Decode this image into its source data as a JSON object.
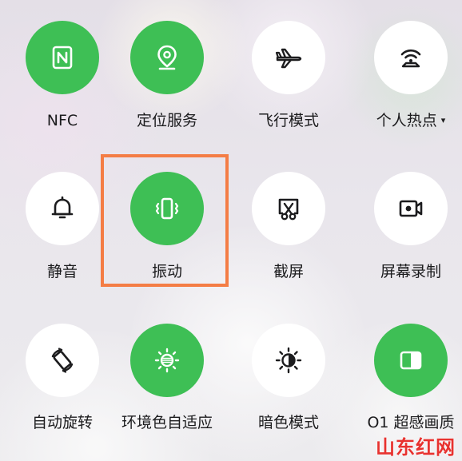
{
  "tiles": [
    {
      "label": "NFC",
      "state": "on",
      "icon": "nfc-icon"
    },
    {
      "label": "定位服务",
      "state": "on",
      "icon": "location-pin-icon"
    },
    {
      "label": "飞行模式",
      "state": "off",
      "icon": "airplane-icon"
    },
    {
      "label": "个人热点",
      "state": "off",
      "icon": "hotspot-icon",
      "has_dropdown": true,
      "dropdown_glyph": "▾"
    },
    {
      "label": "静音",
      "state": "off",
      "icon": "bell-icon"
    },
    {
      "label": "振动",
      "state": "on",
      "icon": "vibrate-icon",
      "highlighted": true
    },
    {
      "label": "截屏",
      "state": "off",
      "icon": "screenshot-icon"
    },
    {
      "label": "屏幕录制",
      "state": "off",
      "icon": "screen-record-icon"
    },
    {
      "label": "自动旋转",
      "state": "off",
      "icon": "auto-rotate-icon"
    },
    {
      "label": "环境色自适应",
      "state": "on",
      "icon": "ambient-color-icon"
    },
    {
      "label": "暗色模式",
      "state": "off",
      "icon": "dark-mode-icon"
    },
    {
      "label": "O1 超感画质",
      "state": "on",
      "icon": "display-quality-icon"
    }
  ],
  "colors": {
    "active": "#3ebf55",
    "inactive": "#ffffff",
    "icon_dark": "#1c1c1e",
    "highlight_border": "#f47d45",
    "watermark": "#e8322f"
  },
  "watermark": "山东红网"
}
